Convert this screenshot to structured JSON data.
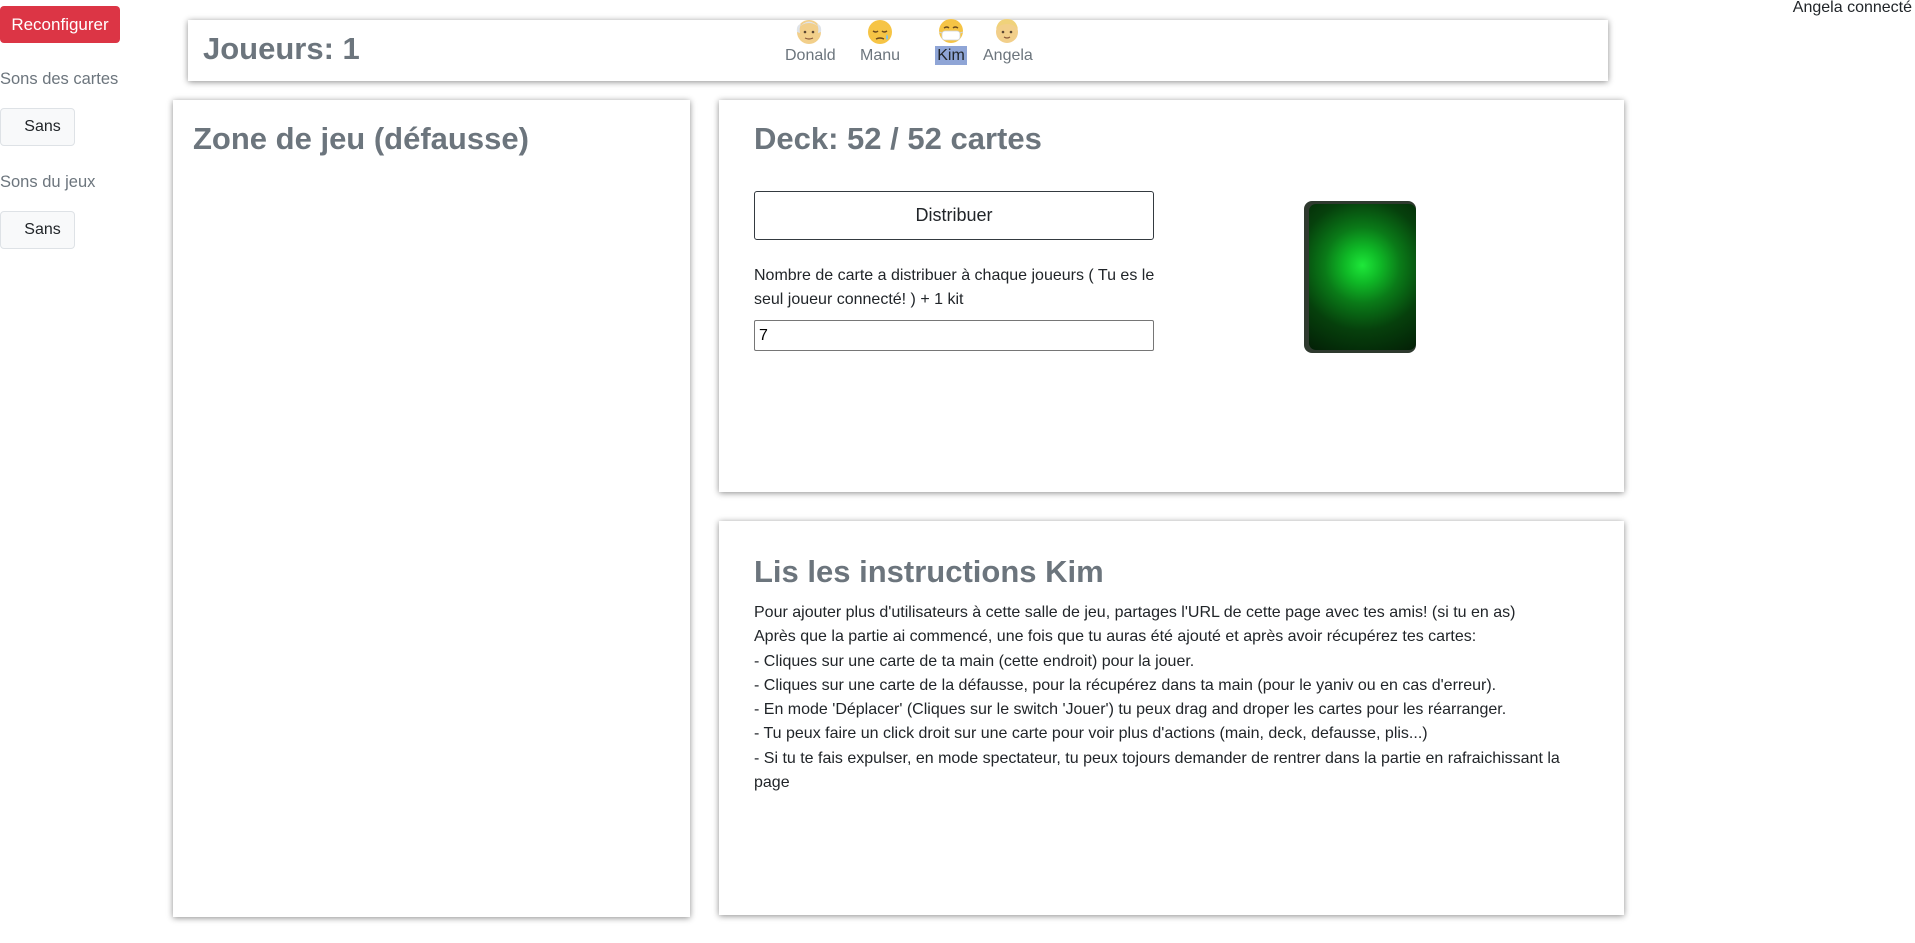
{
  "sidebar": {
    "reconfigure_label": "Reconfigurer",
    "card_sounds_label": "Sons des cartes",
    "card_sounds_value": "Sans",
    "game_sounds_label": "Sons du jeux",
    "game_sounds_value": "Sans"
  },
  "topbar": {
    "players_title": "Joueurs: 1",
    "players": [
      {
        "name": "Donald",
        "icon": "old-man-emoji-icon",
        "active": false
      },
      {
        "name": "Manu",
        "icon": "sleepy-face-emoji-icon",
        "active": false
      },
      {
        "name": "Kim",
        "icon": "mask-face-emoji-icon",
        "active": true
      },
      {
        "name": "Angela",
        "icon": "person-emoji-icon",
        "active": false
      }
    ]
  },
  "status": {
    "connected_text": "Angela connecté"
  },
  "zone": {
    "title": "Zone de jeu (défausse)"
  },
  "deck": {
    "title": "Deck: 52 / 52 cartes",
    "distribute_label": "Distribuer",
    "count_label": "Nombre de carte a distribuer à chaque joueurs ( Tu es le seul joueur connecté! ) + 1 kit",
    "count_value": "7",
    "card_back_color": "#1ee83a"
  },
  "instructions": {
    "title": "Lis les instructions Kim",
    "lines": [
      "Pour ajouter plus d'utilisateurs à cette salle de jeu, partages l'URL de cette page avec tes amis! (si tu en as)",
      "Après que la partie ai commencé, une fois que tu auras été ajouté et après avoir récupérez tes cartes:",
      "- Cliques sur une carte de ta main (cette endroit) pour la jouer.",
      "- Cliques sur une carte de la défausse, pour la récupérez dans ta main (pour le yaniv ou en cas d'erreur).",
      "- En mode 'Déplacer' (Cliques sur le switch 'Jouer') tu peux drag and droper les cartes pour les réarranger.",
      "- Tu peux faire un click droit sur une carte pour voir plus d'actions (main, deck, defausse, plis...)",
      "- Si tu te fais expulser, en mode spectateur, tu peux tojours demander de rentrer dans la partie en rafraichissant la page"
    ]
  },
  "colors": {
    "danger": "#dc3545",
    "muted": "#6c757d",
    "active_highlight": "#8fa5d6"
  }
}
